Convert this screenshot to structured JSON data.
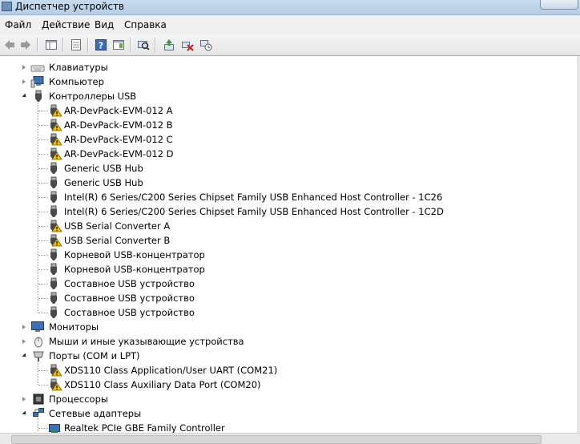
{
  "window": {
    "title": "Диспетчер устройств"
  },
  "menu": [
    "Файл",
    "Действие",
    "Вид",
    "Справка"
  ],
  "toolbar": {
    "buttons": [
      "back-icon",
      "forward-icon",
      "console-tree-icon",
      "properties-page-icon",
      "help-icon",
      "action-pane-icon",
      "scan-hardware-icon",
      "update-driver-icon",
      "uninstall-icon",
      "disable-icon"
    ]
  },
  "colors": {
    "warning": "#f2c200",
    "usb_plug": "#4a4a4a",
    "accent": "#3a6ea5"
  },
  "tree": {
    "keyboards": "Клавиатуры",
    "computer": "Компьютер",
    "usb": {
      "label": "Контроллеры USB",
      "children": [
        {
          "label": "AR-DevPack-EVM-012 A",
          "warning": true
        },
        {
          "label": "AR-DevPack-EVM-012 B",
          "warning": true
        },
        {
          "label": "AR-DevPack-EVM-012 C",
          "warning": true
        },
        {
          "label": "AR-DevPack-EVM-012 D",
          "warning": true
        },
        {
          "label": "Generic USB Hub",
          "warning": false
        },
        {
          "label": "Generic USB Hub",
          "warning": false
        },
        {
          "label": "Intel(R) 6 Series/C200 Series Chipset Family USB Enhanced Host Controller - 1C26",
          "warning": false
        },
        {
          "label": "Intel(R) 6 Series/C200 Series Chipset Family USB Enhanced Host Controller - 1C2D",
          "warning": false
        },
        {
          "label": "USB Serial Converter A",
          "warning": true
        },
        {
          "label": "USB Serial Converter B",
          "warning": true
        },
        {
          "label": "Корневой USB-концентратор",
          "warning": false
        },
        {
          "label": "Корневой USB-концентратор",
          "warning": false
        },
        {
          "label": "Составное USB устройство",
          "warning": false
        },
        {
          "label": "Составное USB устройство",
          "warning": false
        },
        {
          "label": "Составное USB устройство",
          "warning": false
        }
      ]
    },
    "monitors": "Мониторы",
    "mice": "Мыши и иные указывающие устройства",
    "ports": {
      "label": "Порты (COM и LPT)",
      "children": [
        {
          "label": "XDS110 Class Application/User UART (COM21)",
          "warning": true
        },
        {
          "label": "XDS110 Class Auxiliary Data Port (COM20)",
          "warning": true
        }
      ]
    },
    "processors": "Процессоры",
    "network": {
      "label": "Сетевые адаптеры",
      "children": [
        {
          "label": "Realtek PCIe GBE Family Controller"
        }
      ]
    }
  }
}
